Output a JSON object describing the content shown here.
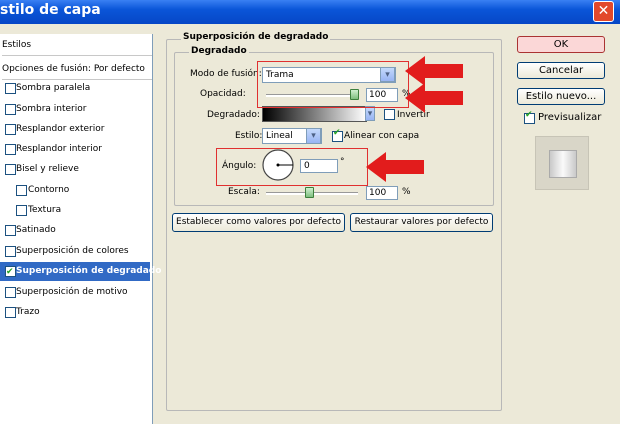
{
  "window": {
    "title": "stilo de capa",
    "close_symbol": "✕"
  },
  "styles_panel": {
    "header": "Estilos",
    "blend_options": "Opciones de fusión: Por defecto",
    "items": [
      {
        "label": "Sombra paralela",
        "checked": false
      },
      {
        "label": "Sombra interior",
        "checked": false
      },
      {
        "label": "Resplandor exterior",
        "checked": false
      },
      {
        "label": "Resplandor interior",
        "checked": false
      },
      {
        "label": "Bisel y relieve",
        "checked": false
      },
      {
        "label": "Contorno",
        "checked": false
      },
      {
        "label": "Textura",
        "checked": false
      },
      {
        "label": "Satinado",
        "checked": false
      },
      {
        "label": "Superposición de colores",
        "checked": false
      },
      {
        "label": "Superposición de degradado",
        "checked": true,
        "selected": true
      },
      {
        "label": "Superposición de motivo",
        "checked": false
      },
      {
        "label": "Trazo",
        "checked": false
      }
    ]
  },
  "gradient_overlay": {
    "section_title": "Superposición de degradado",
    "group_title": "Degradado",
    "blend_mode_label": "Modo de fusión:",
    "blend_mode_value": "Trama",
    "opacity_label": "Opacidad:",
    "opacity_value": "100",
    "opacity_percent": 100,
    "percent": "%",
    "gradient_label": "Degradado:",
    "invert_label": "Invertir",
    "invert_checked": false,
    "style_label": "Estilo:",
    "style_value": "Lineal",
    "align_label": "Alinear con capa",
    "align_checked": true,
    "angle_label": "Ángulo:",
    "angle_value": "0",
    "degree": "°",
    "scale_label": "Escala:",
    "scale_value": "100",
    "scale_percent": 100,
    "set_default_label": "Establecer como valores por defecto",
    "reset_default_label": "Restaurar valores por defecto"
  },
  "buttons": {
    "ok": "OK",
    "cancel": "Cancelar",
    "new_style": "Estilo nuevo...",
    "preview_label": "Previsualizar",
    "preview_checked": true
  },
  "colors": {
    "highlight_red": "#e03030",
    "selection_blue": "#316ac5"
  }
}
